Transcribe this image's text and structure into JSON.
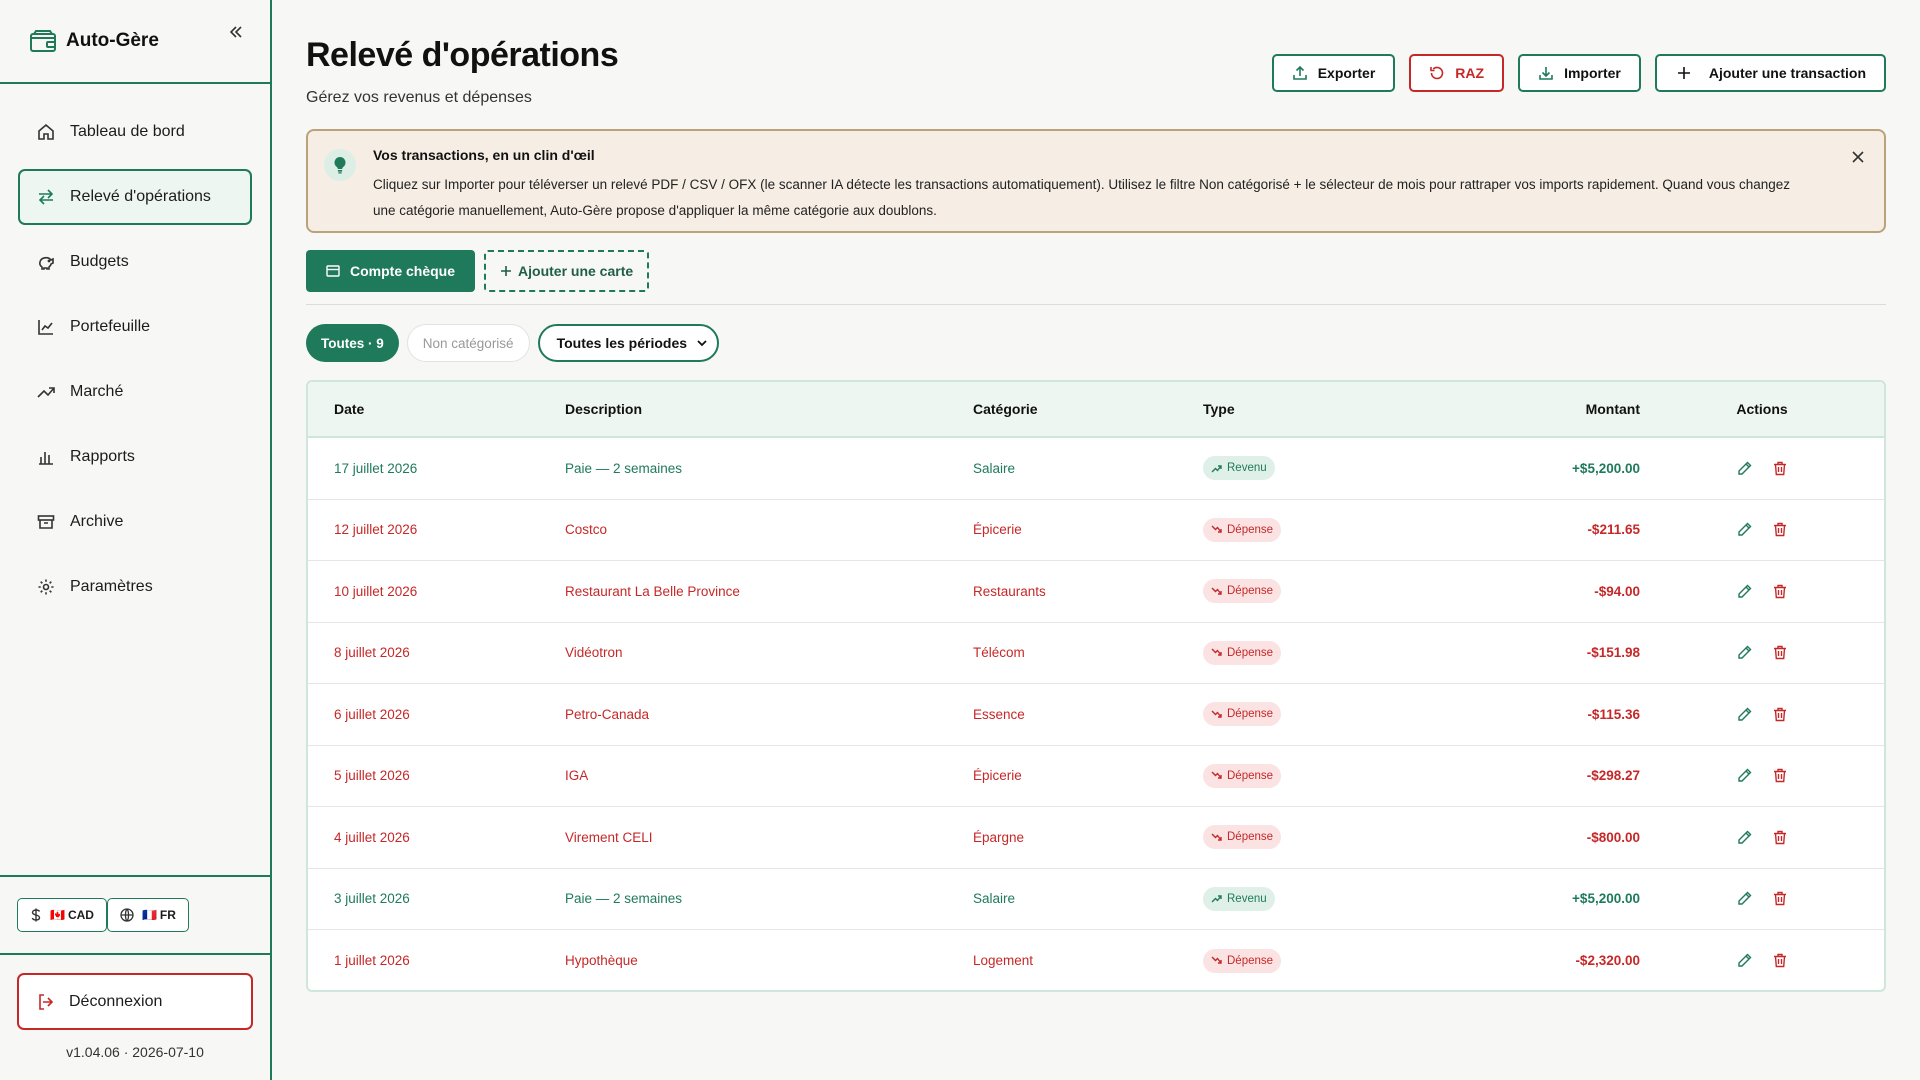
{
  "app": {
    "name": "Auto-Gère",
    "version": "v1.04.06 · 2026-07-10"
  },
  "colors": {
    "accent": "#1f7a5c",
    "danger": "#c62828",
    "tip_bg": "#f6eee4"
  },
  "sidebar": {
    "items": [
      {
        "label": "Tableau de bord",
        "icon": "home-icon"
      },
      {
        "label": "Relevé d'opérations",
        "icon": "transfer-arrows-icon",
        "active": true
      },
      {
        "label": "Budgets",
        "icon": "piggy-bank-icon"
      },
      {
        "label": "Portefeuille",
        "icon": "line-chart-icon"
      },
      {
        "label": "Marché",
        "icon": "trending-up-icon"
      },
      {
        "label": "Rapports",
        "icon": "bar-chart-icon"
      },
      {
        "label": "Archive",
        "icon": "archive-icon"
      },
      {
        "label": "Paramètres",
        "icon": "gear-icon"
      }
    ],
    "currency": {
      "flag": "🇨🇦",
      "label": "CAD"
    },
    "language": {
      "flag": "🇫🇷",
      "label": "FR"
    },
    "logout": "Déconnexion"
  },
  "header": {
    "title": "Relevé d'opérations",
    "subtitle": "Gérez vos revenus et dépenses",
    "export": "Exporter",
    "reset": "RAZ",
    "import": "Importer",
    "add": "Ajouter une transaction"
  },
  "tip": {
    "title": "Vos transactions, en un clin d'œil",
    "body": "Cliquez sur Importer pour téléverser un relevé PDF / CSV / OFX (le scanner IA détecte les transactions automatiquement). Utilisez le filtre Non catégorisé + le sélecteur de mois pour rattraper vos imports rapidement. Quand vous changez une catégorie manuellement, Auto-Gère propose d'appliquer la même catégorie aux doublons."
  },
  "accounts": {
    "current": "Compte chèque",
    "add_card": "Ajouter une carte"
  },
  "filters": {
    "all": "Toutes · 9",
    "uncategorized": "Non catégorisé",
    "period": "Toutes les périodes"
  },
  "table": {
    "headers": {
      "date": "Date",
      "description": "Description",
      "category": "Catégorie",
      "type": "Type",
      "amount": "Montant",
      "actions": "Actions"
    },
    "rows": [
      {
        "date": "17 juillet 2026",
        "description": "Paie — 2 semaines",
        "category": "Salaire",
        "type": "Revenu",
        "kind": "inc",
        "amount": "+$5,200.00"
      },
      {
        "date": "12 juillet 2026",
        "description": "Costco",
        "category": "Épicerie",
        "type": "Dépense",
        "kind": "exp",
        "amount": "-$211.65"
      },
      {
        "date": "10 juillet 2026",
        "description": "Restaurant La Belle Province",
        "category": "Restaurants",
        "type": "Dépense",
        "kind": "exp",
        "amount": "-$94.00"
      },
      {
        "date": "8 juillet 2026",
        "description": "Vidéotron",
        "category": "Télécom",
        "type": "Dépense",
        "kind": "exp",
        "amount": "-$151.98"
      },
      {
        "date": "6 juillet 2026",
        "description": "Petro-Canada",
        "category": "Essence",
        "type": "Dépense",
        "kind": "exp",
        "amount": "-$115.36"
      },
      {
        "date": "5 juillet 2026",
        "description": "IGA",
        "category": "Épicerie",
        "type": "Dépense",
        "kind": "exp",
        "amount": "-$298.27"
      },
      {
        "date": "4 juillet 2026",
        "description": "Virement CELI",
        "category": "Épargne",
        "type": "Dépense",
        "kind": "exp",
        "amount": "-$800.00"
      },
      {
        "date": "3 juillet 2026",
        "description": "Paie — 2 semaines",
        "category": "Salaire",
        "type": "Revenu",
        "kind": "inc",
        "amount": "+$5,200.00"
      },
      {
        "date": "1 juillet 2026",
        "description": "Hypothèque",
        "category": "Logement",
        "type": "Dépense",
        "kind": "exp",
        "amount": "-$2,320.00"
      }
    ]
  }
}
